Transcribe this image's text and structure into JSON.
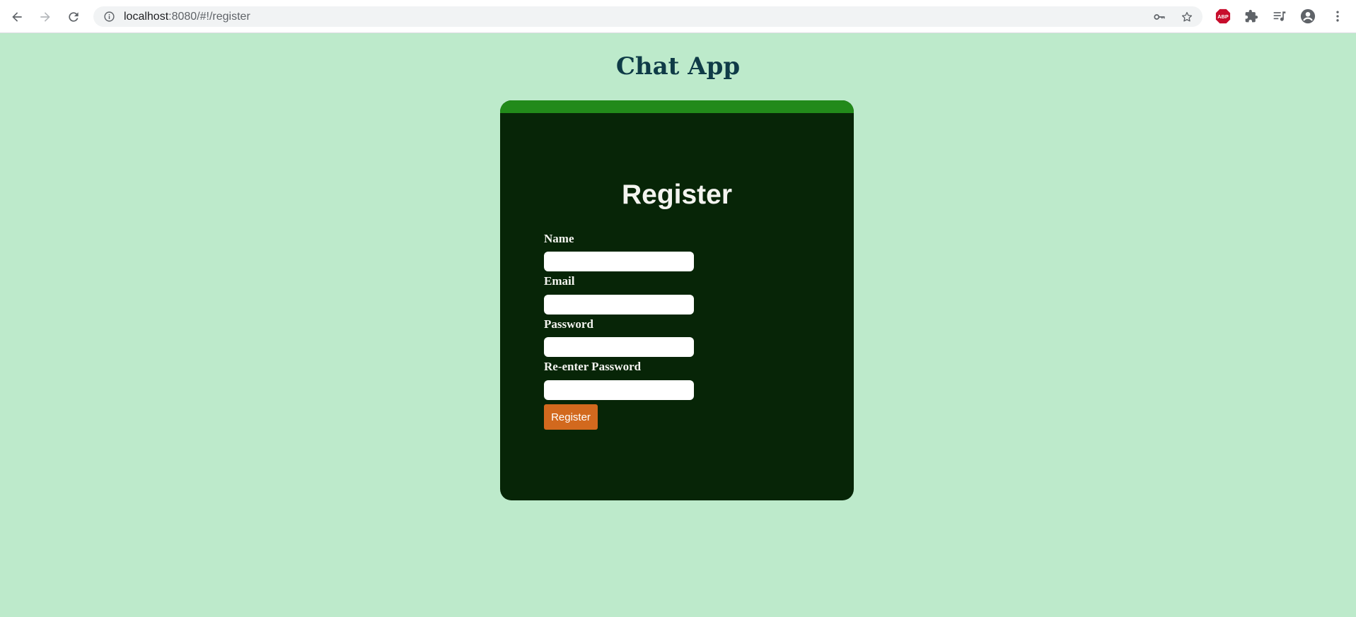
{
  "browser": {
    "url_host": "localhost",
    "url_rest": ":8080/#!/register",
    "icons": [
      "back-icon",
      "forward-icon",
      "reload-icon",
      "site-info-icon",
      "key-icon",
      "star-icon",
      "adblock-icon",
      "extensions-icon",
      "reading-list-icon",
      "profile-icon",
      "menu-icon"
    ],
    "adblock_label": "ABP"
  },
  "page": {
    "title": "Chat App",
    "background": "#bdeacb",
    "title_color": "#0f3b47"
  },
  "card": {
    "background": "#072507",
    "topbar_color": "#228a1a",
    "heading": "Register",
    "fields": [
      {
        "label": "Name",
        "value": "",
        "type": "text"
      },
      {
        "label": "Email",
        "value": "",
        "type": "email"
      },
      {
        "label": "Password",
        "value": "",
        "type": "password"
      },
      {
        "label": "Re-enter Password",
        "value": "",
        "type": "password"
      }
    ],
    "submit_label": "Register",
    "submit_color": "#d2691e"
  }
}
